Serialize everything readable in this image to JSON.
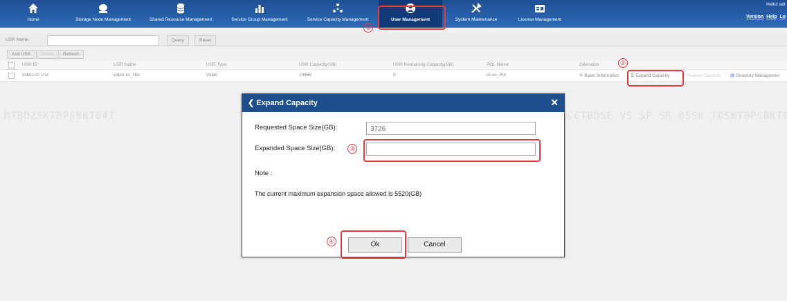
{
  "nav": {
    "items": [
      {
        "label": "Home",
        "icon": "home-icon"
      },
      {
        "label": "Storage Node Management",
        "icon": "storage-node-icon"
      },
      {
        "label": "Shared Resource Management",
        "icon": "database-icon"
      },
      {
        "label": "Service Group Management",
        "icon": "group-icon"
      },
      {
        "label": "Service Capacity Management",
        "icon": "capacity-icon"
      },
      {
        "label": "User Management",
        "icon": "user-icon"
      },
      {
        "label": "System Maintenance",
        "icon": "tools-icon"
      },
      {
        "label": "License Management",
        "icon": "license-icon"
      }
    ],
    "hello": "Hello! adr",
    "version": "Version",
    "help": "Help",
    "logout": "Lo"
  },
  "search": {
    "label": "USR Name:",
    "query": "Query",
    "reset": "Reset"
  },
  "toolbar": {
    "add": "Add USR",
    "delete": "Delete",
    "refresh": "Refresh"
  },
  "table": {
    "headers": [
      "USR ID",
      "USR Name",
      "USR Type",
      "USR Capacity(GB)",
      "USR Remaining Capacity(GB)",
      "POL Name",
      "Operation"
    ],
    "row": {
      "id": "video-cc_Usr",
      "name": "video-cc_Usr",
      "type": "Video",
      "capacity": "10669",
      "remaining": "0",
      "pol": "IA-cc_Pol"
    },
    "ops": {
      "basic": "Basic Information",
      "expand": "Expand Capacity",
      "reduce": "Reduce Capacity",
      "directory": "Directory Managemen"
    }
  },
  "ghost": {
    "left": "MTBDZSKTBPSBKT04I",
    "right": "CCTBDSE VS SP SR 05SK TOSKTBPSBKT04I"
  },
  "modal": {
    "title": "Expand Capacity",
    "requested_label": "Requested Space Size(GB):",
    "requested_value": "3726",
    "expanded_label": "Expanded Space Size(GB):",
    "expanded_value": "",
    "note_label": "Note :",
    "note_text": "The current maximum expansion space allowed is 5520(GB)",
    "ok": "Ok",
    "cancel": "Cancel"
  },
  "annotations": {
    "n1": "①",
    "n2": "②",
    "n3": "③",
    "n4": "④"
  }
}
